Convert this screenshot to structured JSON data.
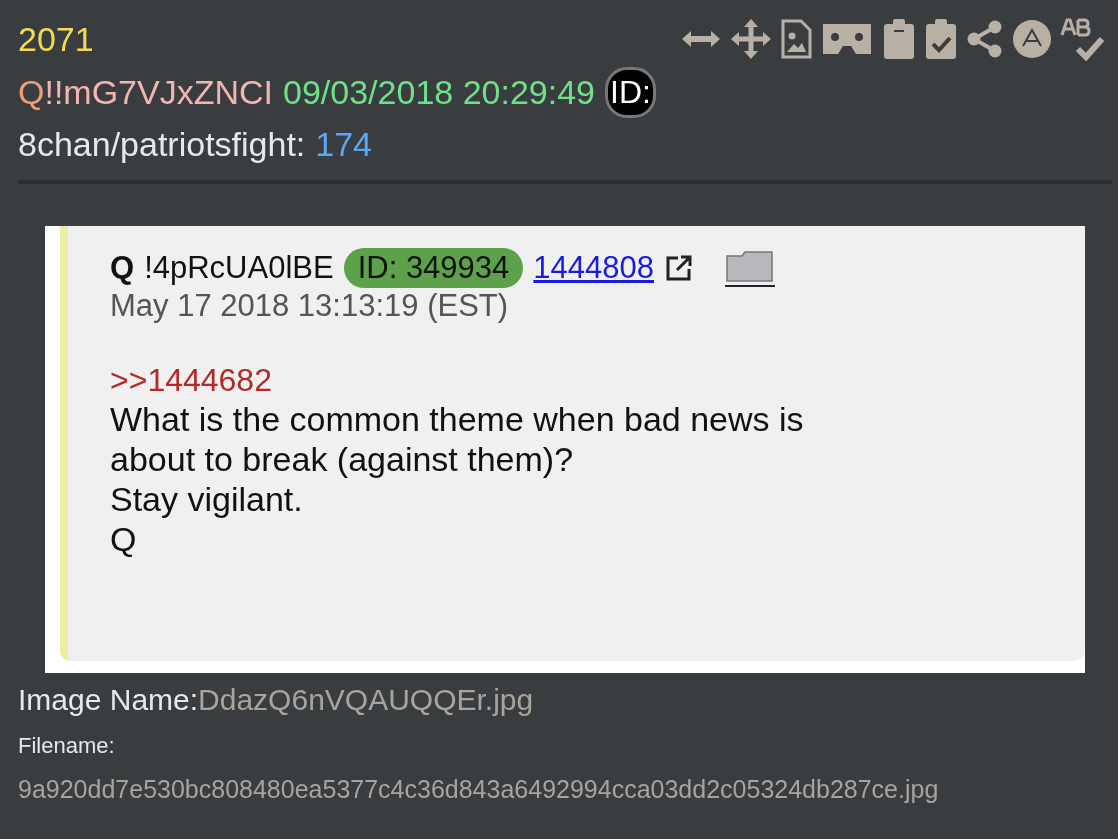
{
  "post_number": "2071",
  "toolbar": [
    {
      "kind": "width"
    },
    {
      "kind": "move"
    },
    {
      "kind": "image-file"
    },
    {
      "kind": "viewer"
    },
    {
      "kind": "clipboard"
    },
    {
      "kind": "clipboard-check"
    },
    {
      "kind": "share"
    },
    {
      "kind": "circle-a"
    },
    {
      "kind": "spellcheck"
    }
  ],
  "author": {
    "name": "Q",
    "tripcode": "!!mG7VJxZNCI",
    "timestamp": "09/03/2018 20:29:49",
    "id_badge": "ID:"
  },
  "source": {
    "board": "8chan/patriotsfight:",
    "post_count": "174"
  },
  "embedded_post": {
    "name": "Q",
    "tripcode": "!4pRcUA0lBE",
    "id": "ID: 349934",
    "post_link": "1444808",
    "date": "May 17 2018 13:13:19 (EST)",
    "reply_link": ">>1444682",
    "lines": [
      "What is the common theme when bad news is",
      "about to break (against them)?",
      "Stay vigilant.",
      "Q"
    ]
  },
  "image_name": {
    "label": "Image Name:",
    "value": "DdazQ6nVQAUQQEr.jpg"
  },
  "filename": {
    "label": "Filename:",
    "value": "9a920dd7e530bc808480ea5377c4c36d843a6492994cca03dd2c05324db287ce.jpg"
  }
}
